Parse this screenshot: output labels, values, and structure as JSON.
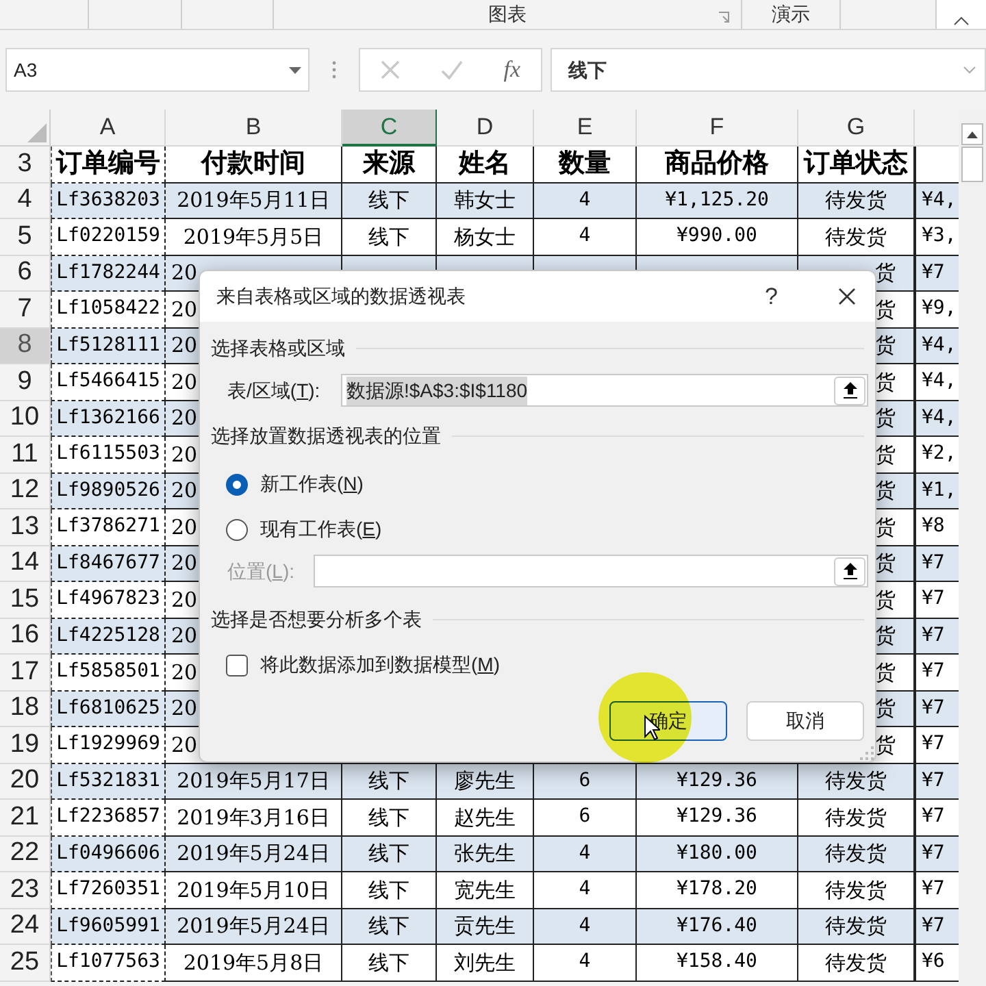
{
  "ribbon": {
    "groups": [
      {
        "label": "图表",
        "launcher": true
      },
      {
        "label": "演示",
        "launcher": false
      }
    ]
  },
  "formula_bar": {
    "name_box": "A3",
    "function_label": "fx",
    "formula": "线下"
  },
  "columns": [
    {
      "letter": "A",
      "selected": false
    },
    {
      "letter": "B",
      "selected": false
    },
    {
      "letter": "C",
      "selected": true
    },
    {
      "letter": "D",
      "selected": false
    },
    {
      "letter": "E",
      "selected": false
    },
    {
      "letter": "F",
      "selected": false
    },
    {
      "letter": "G",
      "selected": false
    }
  ],
  "header_row": {
    "number": "3",
    "cells": [
      "订单编号",
      "付款时间",
      "来源",
      "姓名",
      "数量",
      "商品价格",
      "订单状态"
    ]
  },
  "rows": [
    {
      "number": "4",
      "selected": false,
      "covered": false,
      "cells": [
        "Lf3638203",
        "2019年5月11日",
        "线下",
        "韩女士",
        "4",
        "¥1,125.20",
        "待发货",
        "¥4,"
      ]
    },
    {
      "number": "5",
      "selected": false,
      "covered": false,
      "cells": [
        "Lf0220159",
        "2019年5月5日",
        "线下",
        "杨女士",
        "4",
        "¥990.00",
        "待发货",
        "¥3,"
      ]
    },
    {
      "number": "6",
      "selected": false,
      "covered": true,
      "cells": [
        "Lf1782244",
        "20",
        "",
        "",
        "",
        "",
        "货",
        "¥7"
      ]
    },
    {
      "number": "7",
      "selected": false,
      "covered": true,
      "cells": [
        "Lf1058422",
        "20",
        "",
        "",
        "",
        "",
        "货",
        "¥9,"
      ]
    },
    {
      "number": "8",
      "selected": true,
      "covered": true,
      "cells": [
        "Lf5128111",
        "20",
        "",
        "",
        "",
        "",
        "货",
        "¥4,"
      ]
    },
    {
      "number": "9",
      "selected": false,
      "covered": true,
      "cells": [
        "Lf5466415",
        "20",
        "",
        "",
        "",
        "",
        "货",
        "¥4,"
      ]
    },
    {
      "number": "10",
      "selected": false,
      "covered": true,
      "cells": [
        "Lf1362166",
        "20",
        "",
        "",
        "",
        "",
        "货",
        "¥4,"
      ]
    },
    {
      "number": "11",
      "selected": false,
      "covered": true,
      "cells": [
        "Lf6115503",
        "20",
        "",
        "",
        "",
        "",
        "货",
        "¥2,"
      ]
    },
    {
      "number": "12",
      "selected": false,
      "covered": true,
      "cells": [
        "Lf9890526",
        "20",
        "",
        "",
        "",
        "",
        "货",
        "¥1,"
      ]
    },
    {
      "number": "13",
      "selected": false,
      "covered": true,
      "cells": [
        "Lf3786271",
        "20",
        "",
        "",
        "",
        "",
        "货",
        "¥8"
      ]
    },
    {
      "number": "14",
      "selected": false,
      "covered": true,
      "cells": [
        "Lf8467677",
        "20",
        "",
        "",
        "",
        "",
        "货",
        "¥7"
      ]
    },
    {
      "number": "15",
      "selected": false,
      "covered": true,
      "cells": [
        "Lf4967823",
        "20",
        "",
        "",
        "",
        "",
        "货",
        "¥7"
      ]
    },
    {
      "number": "16",
      "selected": false,
      "covered": true,
      "cells": [
        "Lf4225128",
        "20",
        "",
        "",
        "",
        "",
        "货",
        "¥7"
      ]
    },
    {
      "number": "17",
      "selected": false,
      "covered": true,
      "cells": [
        "Lf5858501",
        "20",
        "",
        "",
        "",
        "",
        "货",
        "¥7"
      ]
    },
    {
      "number": "18",
      "selected": false,
      "covered": true,
      "cells": [
        "Lf6810625",
        "20",
        "",
        "",
        "",
        "",
        "货",
        "¥7"
      ]
    },
    {
      "number": "19",
      "selected": false,
      "covered": true,
      "cells": [
        "Lf1929969",
        "20",
        "",
        "",
        "",
        "",
        "货",
        "¥7"
      ]
    },
    {
      "number": "20",
      "selected": false,
      "covered": false,
      "cells": [
        "Lf5321831",
        "2019年5月17日",
        "线下",
        "廖先生",
        "6",
        "¥129.36",
        "待发货",
        "¥7"
      ]
    },
    {
      "number": "21",
      "selected": false,
      "covered": false,
      "cells": [
        "Lf2236857",
        "2019年3月16日",
        "线下",
        "赵先生",
        "6",
        "¥129.36",
        "待发货",
        "¥7"
      ]
    },
    {
      "number": "22",
      "selected": false,
      "covered": false,
      "cells": [
        "Lf0496606",
        "2019年5月24日",
        "线下",
        "张先生",
        "4",
        "¥180.00",
        "待发货",
        "¥7"
      ]
    },
    {
      "number": "23",
      "selected": false,
      "covered": false,
      "cells": [
        "Lf7260351",
        "2019年5月10日",
        "线下",
        "宽先生",
        "4",
        "¥178.20",
        "待发货",
        "¥7"
      ]
    },
    {
      "number": "24",
      "selected": false,
      "covered": false,
      "cells": [
        "Lf9605991",
        "2019年5月24日",
        "线下",
        "贡先生",
        "4",
        "¥176.40",
        "待发货",
        "¥7"
      ]
    },
    {
      "number": "25",
      "selected": false,
      "covered": false,
      "cells": [
        "Lf1077563",
        "2019年5月8日",
        "线下",
        "刘先生",
        "4",
        "¥158.40",
        "待发货",
        "¥6"
      ]
    }
  ],
  "dialog": {
    "title": "来自表格或区域的数据透视表",
    "help": "?",
    "source_section": "选择表格或区域",
    "range_field": {
      "label_before": "表/区域(",
      "access_key": "T",
      "label_after": "):",
      "value": "数据源!$A$3:$I$1180",
      "disabled": false
    },
    "location_section": "选择放置数据透视表的位置",
    "radios": [
      {
        "label_before": "新工作表(",
        "access_key": "N",
        "label_after": ")",
        "selected": true
      },
      {
        "label_before": "现有工作表(",
        "access_key": "E",
        "label_after": ")",
        "selected": false
      }
    ],
    "location_field": {
      "label_before": "位置(",
      "access_key": "L",
      "label_after": "):",
      "disabled": true
    },
    "multi_section": "选择是否想要分析多个表",
    "checkbox": {
      "label_before": "将此数据添加到数据模型(",
      "access_key": "M",
      "label_after": ")",
      "checked": false
    },
    "buttons": [
      {
        "label": "确定",
        "default": true
      },
      {
        "label": "取消",
        "default": false
      }
    ]
  }
}
